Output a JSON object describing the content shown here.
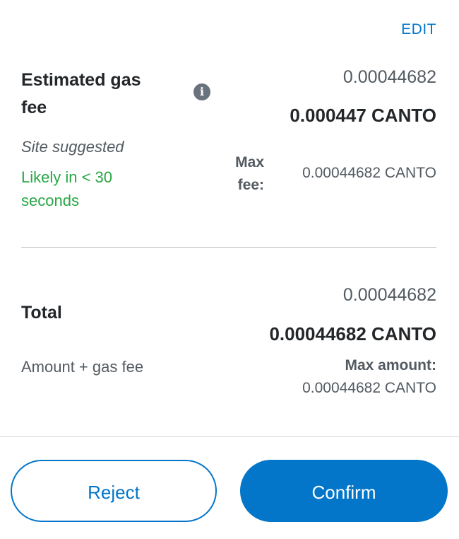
{
  "edit_label": "EDIT",
  "gas": {
    "title_line1": "Estimated gas",
    "title_line2": "fee",
    "info_icon": "info-icon",
    "fiat_value": "0.00044682",
    "crypto_value": "0.000447 CANTO",
    "site_note": "Site suggested",
    "likely_time": "Likely in < 30 seconds",
    "max_fee_label": "Max fee:",
    "max_fee_value": "0.00044682 CANTO"
  },
  "total": {
    "title": "Total",
    "fiat_value": "0.00044682",
    "crypto_value": "0.00044682 CANTO",
    "sub_note": "Amount + gas fee",
    "max_amount_label": "Max amount:",
    "max_amount_value": "0.00044682 CANTO"
  },
  "actions": {
    "reject_label": "Reject",
    "confirm_label": "Confirm"
  },
  "colors": {
    "accent": "#0376c9",
    "success": "#28a745"
  }
}
